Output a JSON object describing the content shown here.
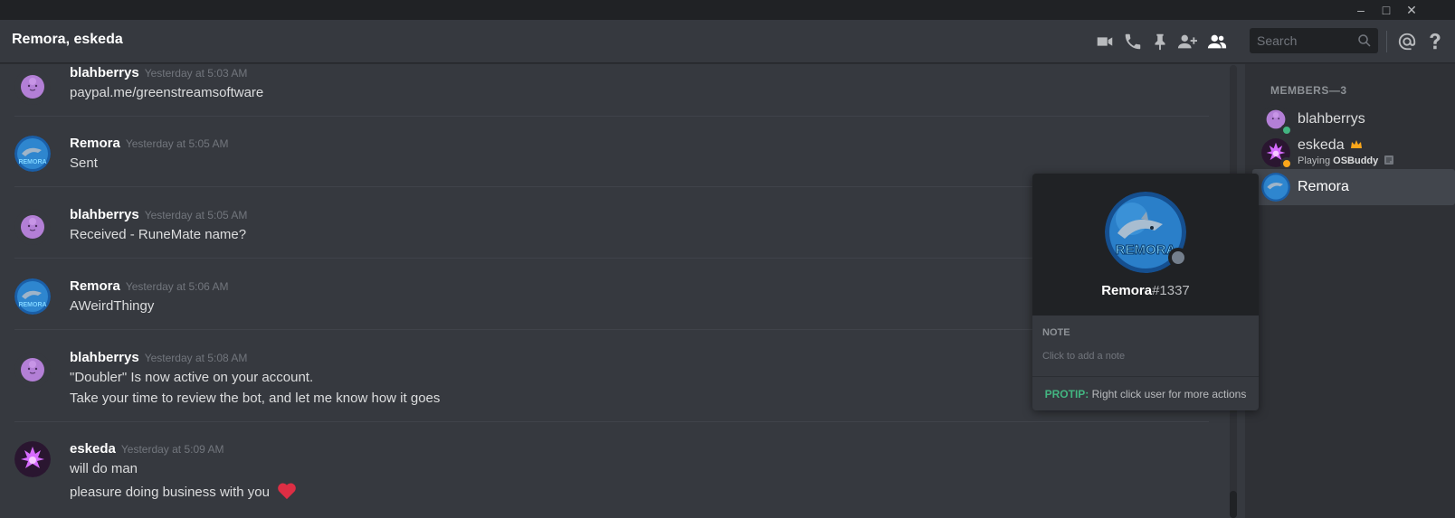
{
  "window": {
    "minimize_glyph": "–",
    "maximize_glyph": "□",
    "close_glyph": "✕"
  },
  "header": {
    "title": "Remora, eskeda",
    "search_placeholder": "Search",
    "icons": [
      "video-call-icon",
      "voice-call-icon",
      "pin-icon",
      "add-friend-icon",
      "member-list-icon",
      "mention-icon",
      "help-icon"
    ]
  },
  "messages": [
    {
      "author": "blahberrys",
      "time": "Yesterday at 5:03 AM",
      "lines": [
        "paypal.me/greenstreamsoftware"
      ],
      "avatar": "blahberrys"
    },
    {
      "author": "Remora",
      "time": "Yesterday at 5:05 AM",
      "lines": [
        "Sent"
      ],
      "avatar": "remora"
    },
    {
      "author": "blahberrys",
      "time": "Yesterday at 5:05 AM",
      "lines": [
        "Received - RuneMate name?"
      ],
      "avatar": "blahberrys"
    },
    {
      "author": "Remora",
      "time": "Yesterday at 5:06 AM",
      "lines": [
        "AWeirdThingy"
      ],
      "avatar": "remora"
    },
    {
      "author": "blahberrys",
      "time": "Yesterday at 5:08 AM",
      "lines": [
        "\"Doubler\" Is now active on your account.",
        "Take your time to review the bot, and let me know how it goes"
      ],
      "avatar": "blahberrys"
    },
    {
      "author": "eskeda",
      "time": "Yesterday at 5:09 AM",
      "lines": [
        "will do man",
        "pleasure doing business with you"
      ],
      "avatar": "eskeda"
    }
  ],
  "members": {
    "header": "MEMBERS—3",
    "list": [
      {
        "name": "blahberrys",
        "status_color": "#43b581"
      },
      {
        "name": "eskeda",
        "status_color": "#faa61a",
        "activity_prefix": "Playing ",
        "activity_game": "OSBuddy"
      },
      {
        "name": "Remora"
      }
    ]
  },
  "popout": {
    "username": "Remora",
    "discriminator": "#1337",
    "avatar_text": "REMORA",
    "note_label": "NOTE",
    "note_placeholder": "Click to add a note",
    "protip_label": "PROTIP:",
    "protip_text": " Right click user for more actions"
  },
  "colors": {
    "accent_green": "#43b581",
    "heart": "#dd2e44",
    "idle": "#faa61a",
    "offline": "#747f8d"
  }
}
